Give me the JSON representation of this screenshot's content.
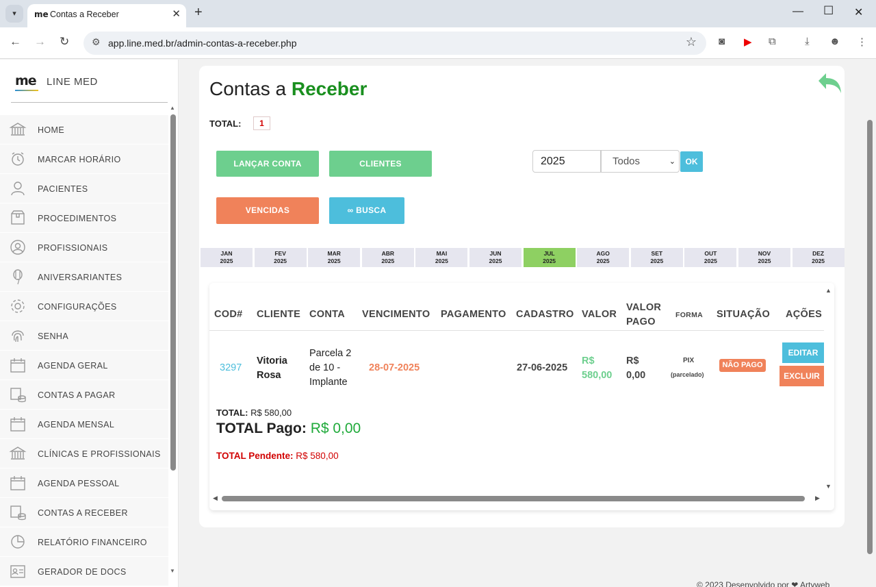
{
  "browser": {
    "tab_favicon": "me",
    "tab_title": "Contas a Receber",
    "url": "app.line.med.br/admin-contas-a-receber.php",
    "icons": [
      "tab-search-icon",
      "close-icon",
      "new-tab-icon",
      "minimize-icon",
      "maximize-icon",
      "window-close-icon",
      "back-icon",
      "forward-icon",
      "reload-icon",
      "site-settings-icon",
      "bookmark-star-icon",
      "camera-icon",
      "youtube-icon",
      "extensions-icon",
      "download-icon",
      "profile-icon",
      "more-icon"
    ]
  },
  "sidebar": {
    "logo": "me",
    "brand": "LINE MED",
    "items": [
      {
        "label": "HOME",
        "icon": "bank-icon"
      },
      {
        "label": "MARCAR HORÁRIO",
        "icon": "alarm-clock-icon"
      },
      {
        "label": "PACIENTES",
        "icon": "user-icon"
      },
      {
        "label": "PROCEDIMENTOS",
        "icon": "box-icon"
      },
      {
        "label": "PROFISSIONAIS",
        "icon": "user-circle-icon"
      },
      {
        "label": "ANIVERSARIANTES",
        "icon": "balloon-icon"
      },
      {
        "label": "CONFIGURAÇÕES",
        "icon": "gear-icon"
      },
      {
        "label": "SENHA",
        "icon": "fingerprint-icon"
      },
      {
        "label": "AGENDA GERAL",
        "icon": "calendar-icon"
      },
      {
        "label": "CONTAS A PAGAR",
        "icon": "money-icon"
      },
      {
        "label": "AGENDA MENSAL",
        "icon": "calendar-icon"
      },
      {
        "label": "CLÍNICAS E PROFISSIONAIS",
        "icon": "bank-icon"
      },
      {
        "label": "AGENDA PESSOAL",
        "icon": "calendar-icon"
      },
      {
        "label": "CONTAS A RECEBER",
        "icon": "money-icon"
      },
      {
        "label": "RELATÓRIO FINANCEIRO",
        "icon": "pie-chart-icon"
      },
      {
        "label": "GERADOR DE DOCS",
        "icon": "id-card-icon"
      }
    ]
  },
  "page": {
    "title_plain": "Contas a",
    "title_bold": "Receber",
    "total_label": "TOTAL:",
    "total_count": "1",
    "buttons": {
      "lancar": "LANÇAR CONTA",
      "clientes": "CLIENTES",
      "vencidas": "VENCIDAS",
      "busca": "∞ BUSCA",
      "ok": "OK"
    },
    "filter": {
      "year": "2025",
      "status_selected": "Todos"
    },
    "months": [
      {
        "m": "JAN",
        "y": "2025"
      },
      {
        "m": "FEV",
        "y": "2025"
      },
      {
        "m": "MAR",
        "y": "2025"
      },
      {
        "m": "ABR",
        "y": "2025"
      },
      {
        "m": "MAI",
        "y": "2025"
      },
      {
        "m": "JUN",
        "y": "2025"
      },
      {
        "m": "JUL",
        "y": "2025",
        "active": true
      },
      {
        "m": "AGO",
        "y": "2025"
      },
      {
        "m": "SET",
        "y": "2025"
      },
      {
        "m": "OUT",
        "y": "2025"
      },
      {
        "m": "NOV",
        "y": "2025"
      },
      {
        "m": "DEZ",
        "y": "2025"
      }
    ]
  },
  "table": {
    "headers": {
      "cod": "COD#",
      "cliente": "CLIENTE",
      "conta": "CONTA",
      "vencimento": "VENCIMENTO",
      "pagamento": "PAGAMENTO",
      "cadastro": "CADASTRO",
      "valor": "VALOR",
      "valor_pago_1": "VALOR",
      "valor_pago_2": "PAGO",
      "forma": "FORMA",
      "situacao": "SITUAÇÃO",
      "acoes": "AÇÕES"
    },
    "rows": [
      {
        "cod": "3297",
        "cliente_1": "Vitoria",
        "cliente_2": "Rosa",
        "conta_1": "Parcela 2",
        "conta_2": "de 10 -",
        "conta_3": "Implante",
        "vencimento": "28-07-2025",
        "pagamento": "",
        "cadastro": "27-06-2025",
        "valor_1": "R$",
        "valor_2": "580,00",
        "valor_pago_1": "R$",
        "valor_pago_2": "0,00",
        "forma": "PIX",
        "forma_sub": "(parcelado)",
        "situacao": "NÃO PAGO",
        "editar": "EDITAR",
        "excluir": "EXCLUIR"
      }
    ],
    "summary": {
      "total_label": "TOTAL:",
      "total_value": "R$ 580,00",
      "pago_label": "TOTAL Pago:",
      "pago_value": "R$ 0,00",
      "pendente_label": "TOTAL Pendente:",
      "pendente_value": "R$ 580,00"
    }
  },
  "footer": {
    "credit": "© 2023 Desenvolvido por ❤ Artyweb"
  },
  "colors": {
    "accent_green": "#1a8f1f",
    "btn_green": "#6dcf8e",
    "btn_orange": "#f0825a",
    "btn_cyan": "#4dbedc",
    "month_active": "#8ed062"
  }
}
